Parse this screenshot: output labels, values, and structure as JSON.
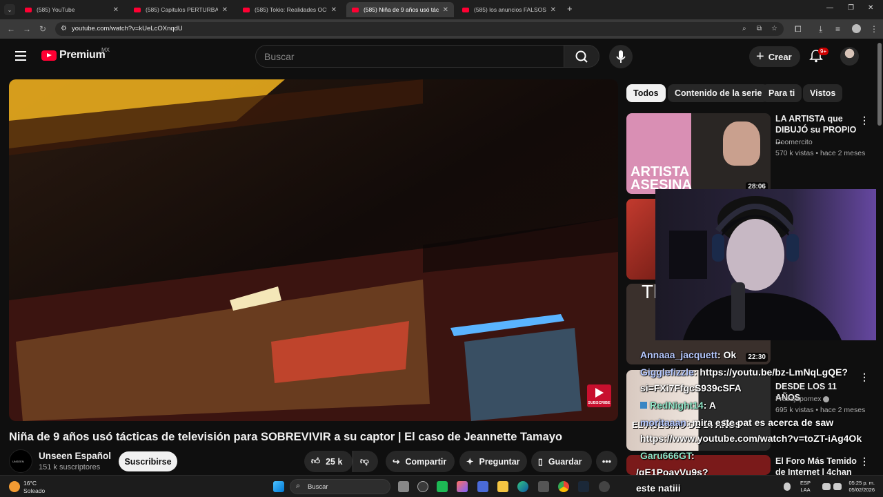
{
  "browser": {
    "tabs": [
      {
        "title": "(585) YouTube",
        "active": false
      },
      {
        "title": "(585) Capitulos PERTURBADORES",
        "active": false
      },
      {
        "title": "(585) Tokio: Realidades OCULTAS",
        "active": false
      },
      {
        "title": "(585) Niña de 9 años usó tácticas",
        "active": true
      },
      {
        "title": "(585) los anuncios FALSOS de J",
        "active": false
      }
    ],
    "url": "youtube.com/watch?v=kUeLcOXnqdU"
  },
  "header": {
    "logo_text": "Premium",
    "region": "MX",
    "search_placeholder": "Buscar",
    "create_label": "Crear",
    "notifications_count": "9+"
  },
  "video": {
    "title": "Niña de 9 años usó tácticas de televisión para SOBREVIVIR a su captor | El caso de Jeannette Tamayo",
    "watermark": "SUBSCRIBE",
    "channel": {
      "name": "Unseen Español",
      "subscribers": "151 k suscriptores",
      "avatar_text": "UNSEEN"
    },
    "subscribe_label": "Suscribirse",
    "likes": "25 k",
    "share_label": "Compartir",
    "ask_label": "Preguntar",
    "save_label": "Guardar"
  },
  "chips": [
    "Todos",
    "Contenido de la serie",
    "Para ti",
    "Vistos"
  ],
  "recommendations": [
    {
      "title": "LA ARTISTA que DIBUJÓ su PROPIO ...",
      "channel": "Doomercito",
      "meta": "570 k vistas • hace 2 meses",
      "duration": "28:06",
      "thumb_text": "ARTISTA ASESINA"
    },
    {
      "title": "",
      "channel": "",
      "meta": "",
      "duration": "",
      "thumb_text": ""
    },
    {
      "title": "",
      "channel": "",
      "meta": "",
      "duration": "22:30",
      "thumb_text": "Th"
    },
    {
      "title": "DESDE LOS 11 AÑOS",
      "channel": "Fresajapomex",
      "meta": "695 k vistas • hace 2 meses",
      "duration": "",
      "thumb_text": "EL ASESINO DE 14 AÑOS"
    },
    {
      "title": "El Foro Más Temido de Internet | 4chan",
      "channel": "",
      "meta": "",
      "duration": "",
      "thumb_text": ""
    }
  ],
  "chat": [
    {
      "user": "Annaaa_jacquett",
      "text": ": Ok"
    },
    {
      "user": "Gigglefizzle",
      "text": ": https://youtu.be/bz-LmNqLgQE?"
    },
    {
      "user": "",
      "text": "si=FXi7FfgcS939cSFA"
    },
    {
      "user": "RedNight14",
      "text": ": A"
    },
    {
      "user": "moritaaan",
      "text": ": mira este pat es acerca de saw"
    },
    {
      "user": "",
      "text": "https://www.youtube.com/watch?v=toZT-iAg4Ok"
    },
    {
      "user": "Garu666GT",
      "text": ":"
    },
    {
      "user": "",
      "text": "/gE1PoayVu9s?"
    },
    {
      "user": "",
      "text": "este natiii"
    }
  ],
  "taskbar": {
    "temperature": "16°C",
    "weather": "Soleado",
    "search_label": "Buscar",
    "lang_1": "ESP",
    "lang_2": "LAA",
    "time": "05:25 p. m.",
    "date": "05/02/2026"
  },
  "colors": {
    "accent": "#ff0033",
    "background": "#0f0f0f"
  }
}
